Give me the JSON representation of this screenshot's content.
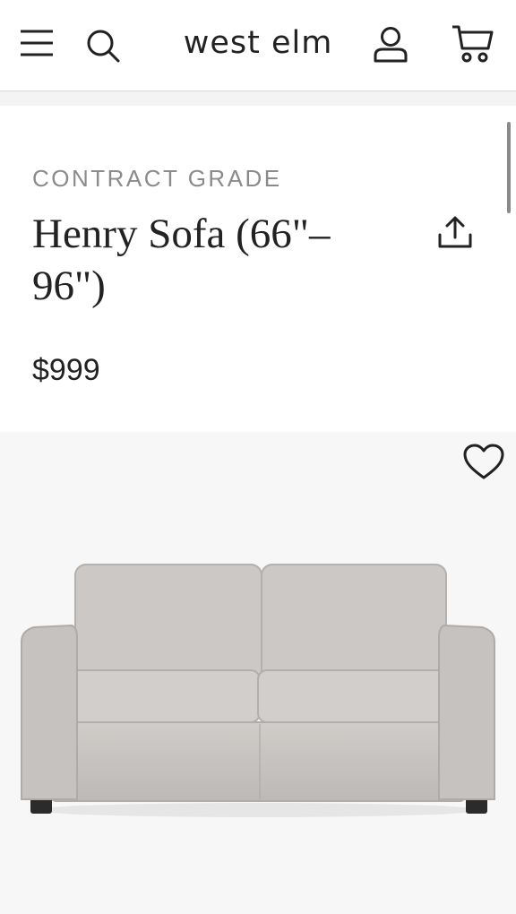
{
  "header": {
    "brand": "west elm",
    "icons": [
      "menu-icon",
      "search-icon",
      "account-icon",
      "cart-icon"
    ]
  },
  "product": {
    "eyebrow": "CONTRACT GRADE",
    "title": "Henry Sofa (66\"–96\")",
    "price": "$999",
    "image_alt": "Henry Sofa"
  },
  "colors": {
    "text": "#222222",
    "muted": "#8b8b8b",
    "sofa_fabric": "#c9c5c2",
    "image_bg": "#f7f7f7"
  }
}
